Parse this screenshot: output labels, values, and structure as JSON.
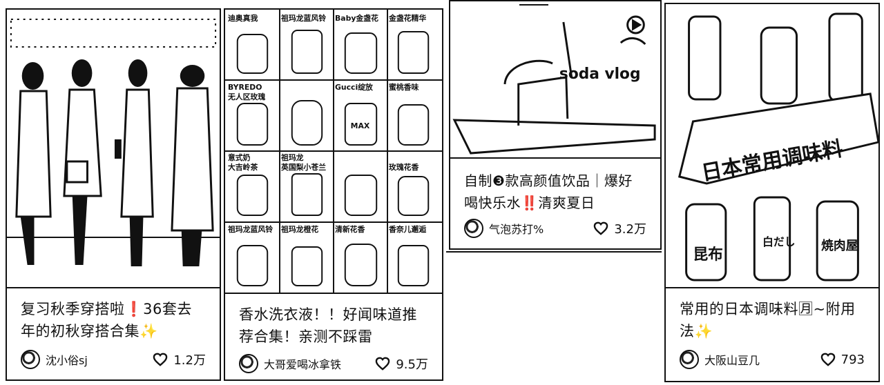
{
  "feed": {
    "cards": [
      {
        "title": "复习秋季穿搭啦❗36套去年的初秋穿搭合集✨",
        "author": "沈小俗sj",
        "likes": "1.2万",
        "cover_icon": "fashion-photo-icon"
      },
      {
        "title": "香水洗衣液！！好闻味道推荐合集！亲测不踩雷",
        "author": "大哥爱喝冰拿铁",
        "likes": "9.5万",
        "cover_icon": "detergent-grid-icon",
        "cover_labels": [
          "迪奥真我",
          "祖玛龙蓝风铃",
          "Baby金盏花",
          "金盏花精华",
          "BYREDO",
          "无人区玫瑰",
          "Gucci绽放",
          "蜜桃香味",
          "意式奶",
          "大吉岭茶",
          "祖玛龙",
          "英国梨小苍兰",
          "MAX",
          "玫瑰花香",
          "祖玛龙蓝风铃",
          "祖玛龙橙花",
          "清新花香",
          "香奈儿邂逅"
        ]
      },
      {
        "title": "自制❸款高颜值饮品｜爆好喝快乐水‼️清爽夏日",
        "author": "气泡苏打%",
        "likes": "3.2万",
        "cover_icon": "drink-vlog-icon",
        "cover_text": "soda vlog"
      },
      {
        "title": "常用的日本调味料🈷~附用法✨",
        "author": "大阪山豆几",
        "likes": "793",
        "cover_icon": "seasoning-bottles-icon",
        "cover_banner": "日本常用调味料",
        "cover_labels": [
          "昆布",
          "白だし",
          "焼肉屋"
        ]
      }
    ]
  },
  "colors": {
    "ink": "#111111",
    "paper": "#ffffff"
  }
}
